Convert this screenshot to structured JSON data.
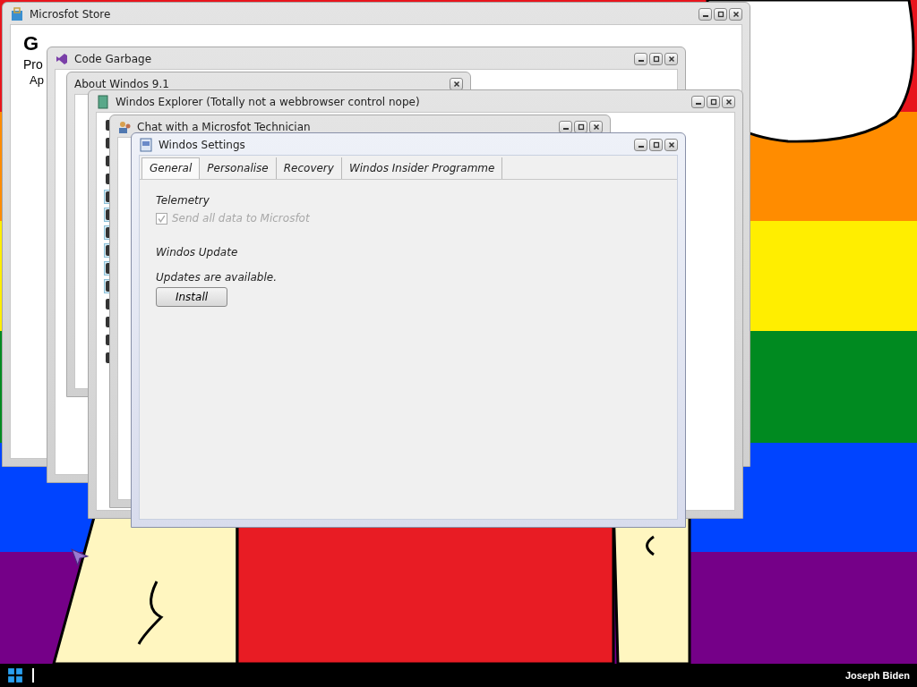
{
  "windows": [
    {
      "title": "Microsfot Store",
      "controls": [
        {
          "kind": "minimize"
        },
        {
          "kind": "maximize"
        },
        {
          "kind": "close"
        }
      ],
      "heading": "G",
      "lines": [
        "Pro",
        "Ap"
      ]
    },
    {
      "title": "Code Garbage",
      "controls": [
        {
          "kind": "minimize"
        },
        {
          "kind": "maximize"
        },
        {
          "kind": "close"
        }
      ]
    },
    {
      "title": "About Windos 9.1",
      "controls": [
        {
          "kind": "close"
        }
      ]
    },
    {
      "title": "Windos Explorer (Totally not a webbrowser control nope)",
      "controls": [
        {
          "kind": "minimize"
        },
        {
          "kind": "maximize"
        },
        {
          "kind": "close"
        }
      ]
    },
    {
      "title": "Chat with a Microsfot Technician",
      "controls": [
        {
          "kind": "minimize"
        },
        {
          "kind": "maximize"
        },
        {
          "kind": "close"
        }
      ]
    },
    {
      "title": "Windos Settings",
      "controls": [
        {
          "kind": "minimize"
        },
        {
          "kind": "maximize"
        },
        {
          "kind": "close"
        }
      ]
    }
  ],
  "settings": {
    "tabs": [
      {
        "label": "General",
        "selected": true
      },
      {
        "label": "Personalise",
        "selected": false
      },
      {
        "label": "Recovery",
        "selected": false
      },
      {
        "label": "Windos Insider Programme",
        "selected": false
      }
    ],
    "telemetry": {
      "heading": "Telemetry",
      "checkbox": {
        "label": "Send all data to Microsfot",
        "checked": true,
        "disabled": true
      }
    },
    "update": {
      "heading": "Windos Update",
      "status": "Updates are available.",
      "button": "Install"
    }
  },
  "taskbar": {
    "user": "Joseph Biden"
  }
}
